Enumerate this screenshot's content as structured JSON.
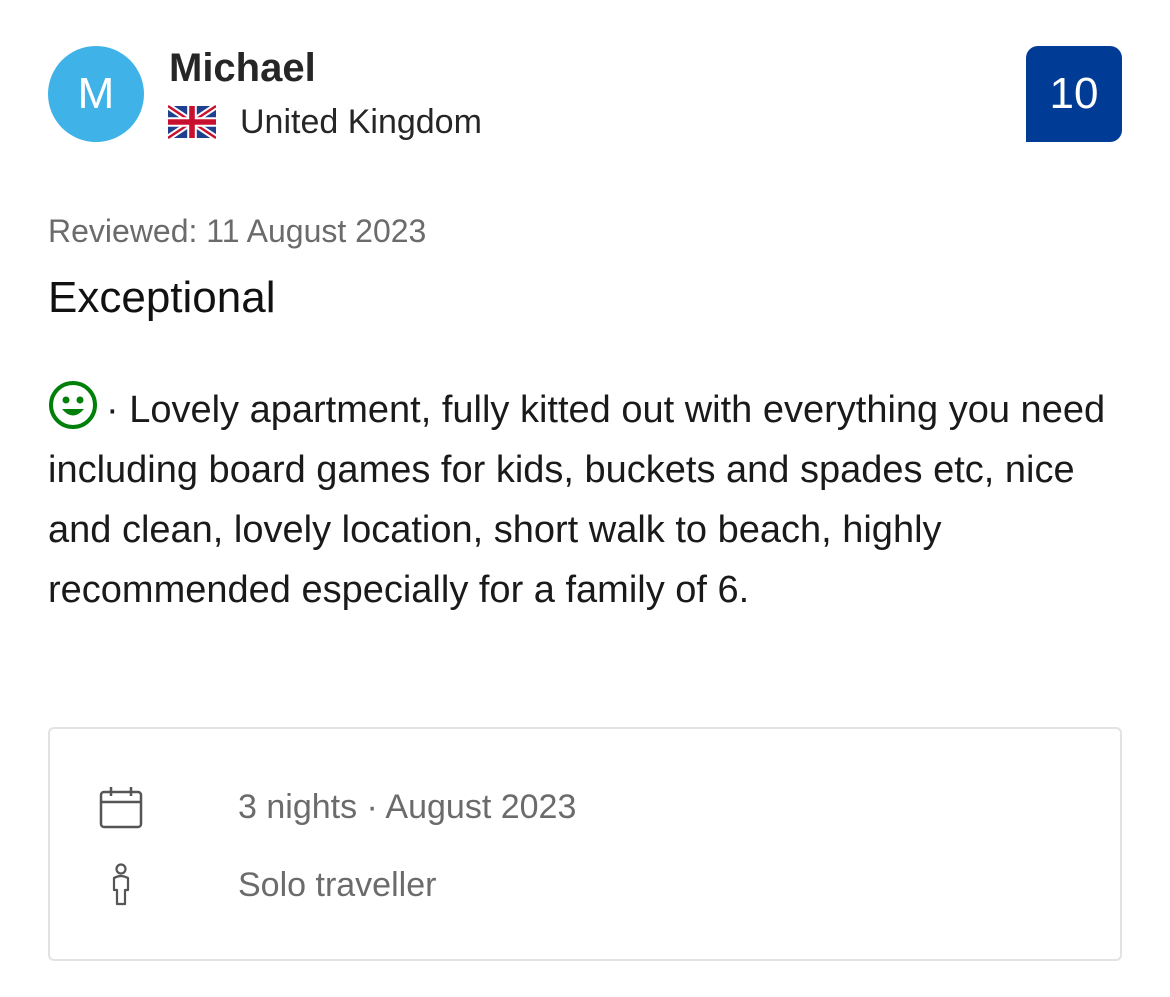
{
  "reviewer": {
    "initial": "M",
    "name": "Michael",
    "country": "United Kingdom",
    "flag_icon": "uk-flag-icon"
  },
  "score": "10",
  "review": {
    "date": "Reviewed: 11 August 2023",
    "title": "Exceptional",
    "positive_icon": "smiley-face-icon",
    "body": "· Lovely apartment, fully kitted out with everything you need including board games for kids, buckets and spades etc, nice and clean, lovely location, short walk to beach, highly recommended especially for a family of 6."
  },
  "stay": {
    "duration": "3 nights · August 2023",
    "duration_icon": "calendar-icon",
    "traveller_type": "Solo traveller",
    "traveller_icon": "person-icon"
  },
  "colors": {
    "avatar": "#3fb3e8",
    "score_badge": "#003b95",
    "positive": "#008009",
    "muted_text": "#6b6b6b"
  }
}
